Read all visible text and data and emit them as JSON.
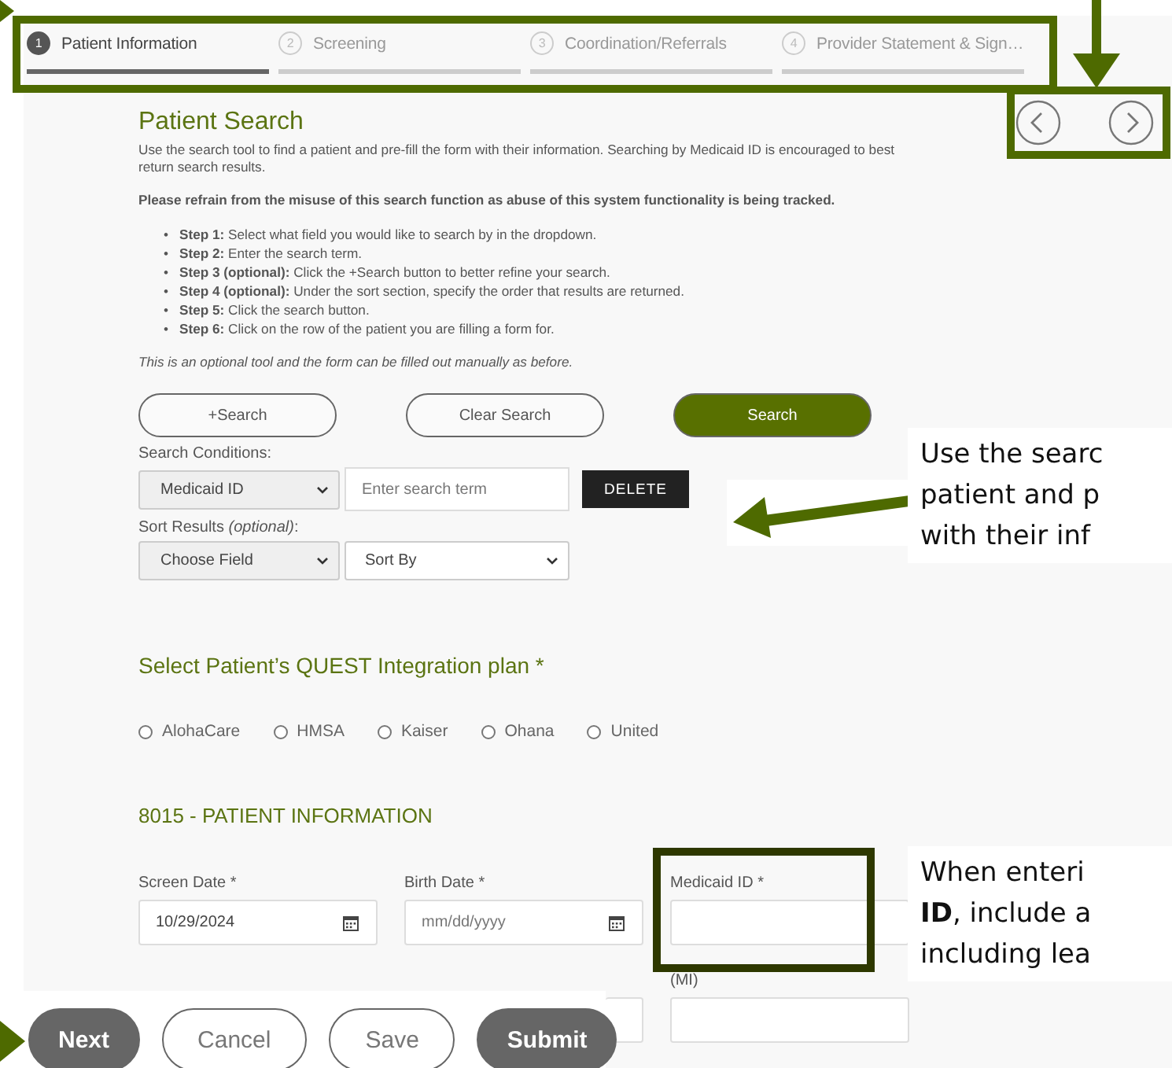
{
  "steps": [
    {
      "number": "1",
      "label": "Patient Information",
      "selected": true
    },
    {
      "number": "2",
      "label": "Screening",
      "selected": false
    },
    {
      "number": "3",
      "label": "Coordination/Referrals",
      "selected": false
    },
    {
      "number": "4",
      "label": "Provider Statement & Sign…",
      "selected": false
    }
  ],
  "search": {
    "title": "Patient Search",
    "intro": "Use the search tool to find a patient and pre-fill the form with their information. Searching by Medicaid ID is encouraged to best return search results.",
    "warning": "Please refrain from the misuse of this search function as abuse of this system functionality is being tracked.",
    "steps": [
      {
        "bullet": "•",
        "label": "Step 1:",
        "text": "Select what field you would like to search by in the dropdown."
      },
      {
        "bullet": "•",
        "label": "Step 2:",
        "text": "Enter the search term."
      },
      {
        "bullet": "•",
        "label": "Step 3 (optional):",
        "text": "Click the +Search button to better refine your search."
      },
      {
        "bullet": "•",
        "label": "Step 4 (optional):",
        "text": "Under the sort section, specify the order that results are returned."
      },
      {
        "bullet": "•",
        "label": "Step 5:",
        "text": "Click the search button."
      },
      {
        "bullet": "•",
        "label": "Step 6:",
        "text": "Click on the row of the patient you are filling a form for."
      }
    ],
    "note": "This is an optional tool and the form can be filled out manually as before.",
    "buttons": [
      {
        "label": "+Search",
        "kind": "outline"
      },
      {
        "label": "Clear Search",
        "kind": "outline"
      },
      {
        "label": "Search",
        "kind": "primary"
      }
    ],
    "conditions_label": "Search Conditions:",
    "condition": {
      "field": "Medicaid ID",
      "placeholder": "Enter search term",
      "delete": "DELETE"
    },
    "sort_label": "Sort Results *(optional)*:",
    "sort": {
      "field": "Choose Field",
      "order": "Sort By"
    }
  },
  "plan": {
    "title": "Select Patient’s QUEST Integration plan *",
    "options": [
      {
        "label": "AlohaCare",
        "selected": false
      },
      {
        "label": "HMSA",
        "selected": false
      },
      {
        "label": "Kaiser",
        "selected": false
      },
      {
        "label": "Ohana",
        "selected": false
      },
      {
        "label": "United",
        "selected": false
      }
    ]
  },
  "patient_info": {
    "title": "8015 - PATIENT INFORMATION",
    "fields": [
      {
        "label": "Screen Date *",
        "value": "10/29/2024",
        "kind": "date"
      },
      {
        "label": "Birth Date *",
        "placeholder": "mm/dd/yyyy",
        "kind": "date"
      },
      {
        "label": "Medicaid ID *",
        "kind": "text"
      }
    ],
    "second_row": [
      {
        "kind": "text"
      },
      {
        "label": "(MI)",
        "kind": "text"
      }
    ]
  },
  "footer_buttons": [
    {
      "label": "Next",
      "kind": "filled"
    },
    {
      "label": "Cancel",
      "kind": "outline"
    },
    {
      "label": "Save",
      "kind": "outline"
    },
    {
      "label": "Submit",
      "kind": "filled"
    }
  ],
  "callouts": [
    {
      "lines": [
        "Use the searc",
        "patient and p",
        "with their inf"
      ]
    },
    {
      "lines": [
        "When enteri",
        "**ID**, include a",
        "including lea"
      ]
    }
  ]
}
